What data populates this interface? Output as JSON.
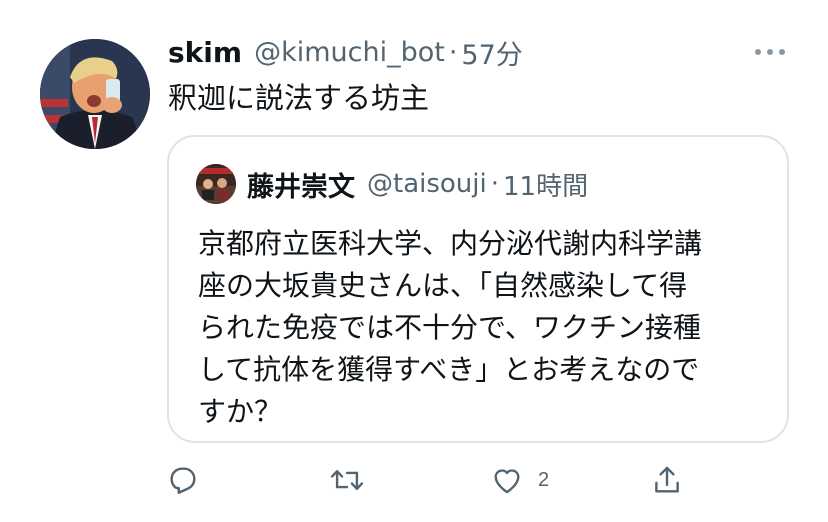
{
  "tweet": {
    "author_name": "skim",
    "author_handle": "@kimuchi_bot",
    "separator": "·",
    "time": "57分",
    "text": "釈迦に説法する坊主",
    "avatar_icon": "user-avatar-photo",
    "more_icon": "more-options-icon"
  },
  "quote": {
    "author_name": "藤井崇文",
    "author_handle": "@taisouji",
    "separator": "·",
    "time": "11時間",
    "avatar_icon": "quoted-user-avatar-photo",
    "lines": [
      "京都府立医科大学、内分泌代謝内科学講",
      "座の大坂貴史さんは、「自然感染して得",
      "られた免疫では不十分で、ワクチン接種",
      "して抗体を獲得すべき」とお考えなので",
      "すか？"
    ]
  },
  "actions": {
    "reply_icon": "reply-icon",
    "retweet_icon": "retweet-icon",
    "like_icon": "like-heart-icon",
    "like_count": "2",
    "share_icon": "share-icon",
    "icon_color": "#536471"
  }
}
